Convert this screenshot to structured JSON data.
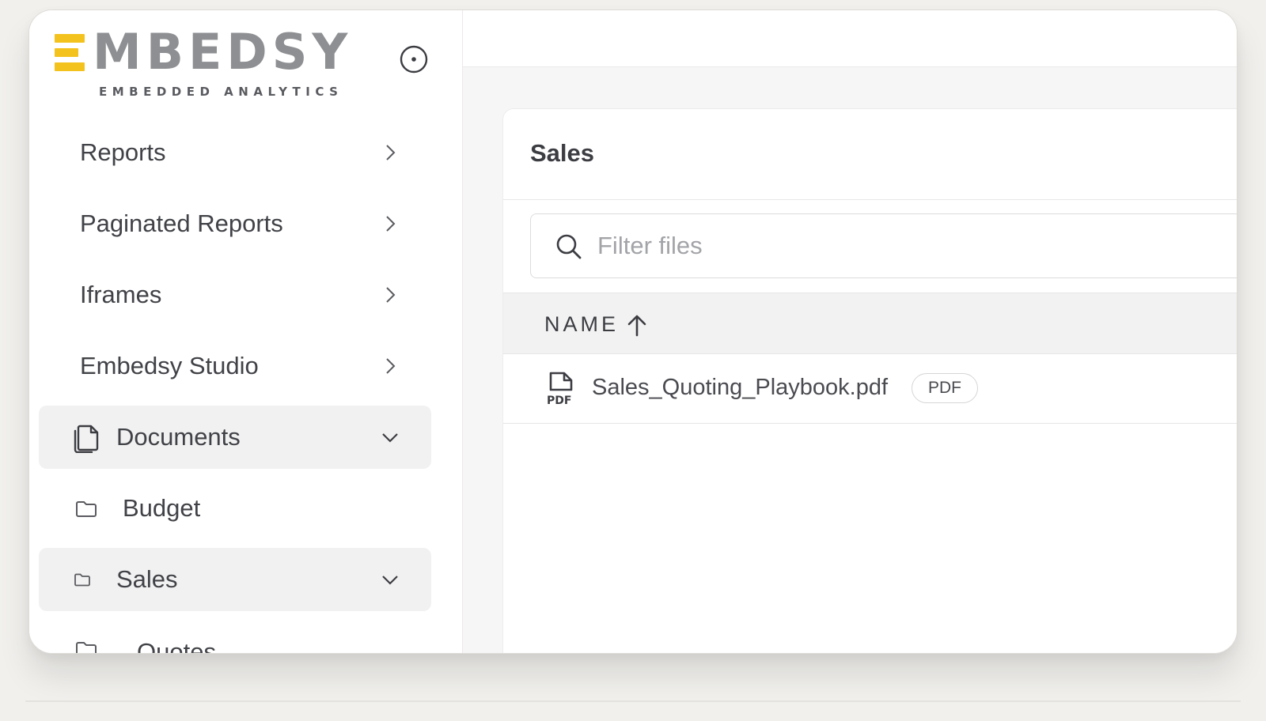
{
  "brand": {
    "name": "MBEDSY",
    "tagline": "EMBEDDED ANALYTICS",
    "accent_color": "#f4c21d",
    "logo_mark_icon": "stacked-bars-logo"
  },
  "sidebar": {
    "collapse_icon": "circle-dot-icon",
    "items": [
      {
        "label": "Reports",
        "icon": "chevron-right-icon"
      },
      {
        "label": "Paginated Reports",
        "icon": "chevron-right-icon"
      },
      {
        "label": "Iframes",
        "icon": "chevron-right-icon"
      },
      {
        "label": "Embedsy Studio",
        "icon": "chevron-right-icon"
      },
      {
        "label": "Documents",
        "icon": "documents-icon",
        "expanded": true
      },
      {
        "label": "Budget",
        "icon": "folder-icon"
      },
      {
        "label": "Sales",
        "icon": "folder-icon",
        "expanded": true
      },
      {
        "label": "Quotes",
        "icon": "folder-icon"
      }
    ]
  },
  "main": {
    "folder_title": "Sales",
    "filter": {
      "placeholder": "Filter files",
      "value": ""
    },
    "table": {
      "column_name": "NAME",
      "sort_icon": "arrow-up-icon",
      "rows": [
        {
          "name": "Sales_Quoting_Playbook.pdf",
          "type": "PDF",
          "icon": "pdf-file-icon"
        }
      ]
    }
  }
}
